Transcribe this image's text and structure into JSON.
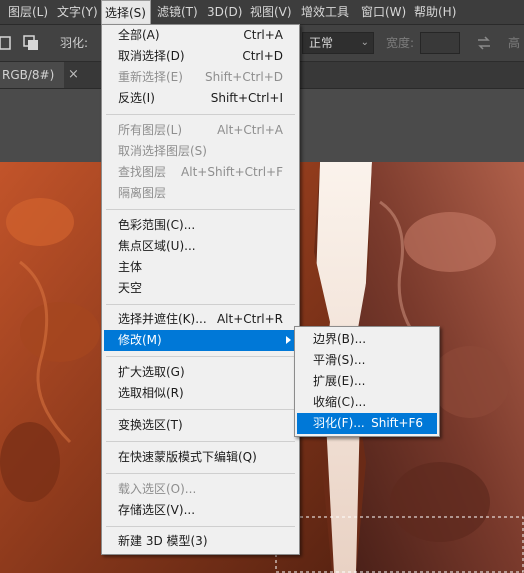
{
  "menubar": {
    "items": [
      {
        "label": "图层(L)"
      },
      {
        "label": "文字(Y)"
      },
      {
        "label": "选择(S)",
        "active": true
      },
      {
        "label": "滤镜(T)"
      },
      {
        "label": "3D(D)"
      },
      {
        "label": "视图(V)"
      },
      {
        "label": "增效工具"
      },
      {
        "label": "窗口(W)"
      },
      {
        "label": "帮助(H)"
      }
    ]
  },
  "options_bar": {
    "feather_label": "羽化:",
    "style_value": "正常",
    "width_label": "宽度:",
    "height_label": "高"
  },
  "document_tab": {
    "title": "RGB/8#)",
    "close_symbol": "×"
  },
  "select_menu": {
    "items": [
      {
        "label": "全部(A)",
        "shortcut": "Ctrl+A",
        "disabled": false
      },
      {
        "label": "取消选择(D)",
        "shortcut": "Ctrl+D",
        "disabled": false
      },
      {
        "label": "重新选择(E)",
        "shortcut": "Shift+Ctrl+D",
        "disabled": true
      },
      {
        "label": "反选(I)",
        "shortcut": "Shift+Ctrl+I",
        "disabled": false
      },
      {
        "separator": true
      },
      {
        "label": "所有图层(L)",
        "shortcut": "Alt+Ctrl+A",
        "disabled": true
      },
      {
        "label": "取消选择图层(S)",
        "shortcut": "",
        "disabled": true
      },
      {
        "label": "查找图层",
        "shortcut": "Alt+Shift+Ctrl+F",
        "disabled": true
      },
      {
        "label": "隔离图层",
        "shortcut": "",
        "disabled": true
      },
      {
        "separator": true
      },
      {
        "label": "色彩范围(C)...",
        "shortcut": "",
        "disabled": false
      },
      {
        "label": "焦点区域(U)...",
        "shortcut": "",
        "disabled": false
      },
      {
        "label": "主体",
        "shortcut": "",
        "disabled": false
      },
      {
        "label": "天空",
        "shortcut": "",
        "disabled": false
      },
      {
        "separator": true
      },
      {
        "label": "选择并遮住(K)...",
        "shortcut": "Alt+Ctrl+R",
        "disabled": false
      },
      {
        "label": "修改(M)",
        "shortcut": "",
        "disabled": false,
        "highlight": true,
        "submenu": true
      },
      {
        "separator": true
      },
      {
        "label": "扩大选取(G)",
        "shortcut": "",
        "disabled": false
      },
      {
        "label": "选取相似(R)",
        "shortcut": "",
        "disabled": false
      },
      {
        "separator": true
      },
      {
        "label": "变换选区(T)",
        "shortcut": "",
        "disabled": false
      },
      {
        "separator": true
      },
      {
        "label": "在快速蒙版模式下编辑(Q)",
        "shortcut": "",
        "disabled": false
      },
      {
        "separator": true
      },
      {
        "label": "载入选区(O)...",
        "shortcut": "",
        "disabled": true
      },
      {
        "label": "存储选区(V)...",
        "shortcut": "",
        "disabled": false
      },
      {
        "separator": true
      },
      {
        "label": "新建 3D 模型(3)",
        "shortcut": "",
        "disabled": false
      }
    ]
  },
  "modify_submenu": {
    "items": [
      {
        "label": "边界(B)...",
        "shortcut": ""
      },
      {
        "label": "平滑(S)...",
        "shortcut": ""
      },
      {
        "label": "扩展(E)...",
        "shortcut": ""
      },
      {
        "label": "收缩(C)...",
        "shortcut": ""
      },
      {
        "label": "羽化(F)...",
        "shortcut": "Shift+F6",
        "highlight": true
      }
    ]
  },
  "colors": {
    "menu_highlight": "#0078d7",
    "menu_bg": "#f0f0f0",
    "app_bg": "#535353"
  }
}
